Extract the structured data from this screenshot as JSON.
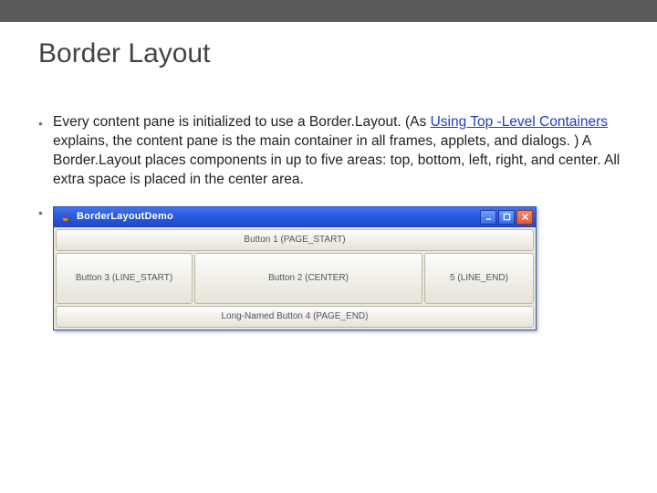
{
  "slide": {
    "title": "Border Layout",
    "paragraph_pre": "Every content pane is initialized to use a Border.Layout. (As ",
    "link_text": "Using Top -Level Containers",
    "paragraph_post": " explains, the content pane is the main container in all frames, applets, and dialogs. ) A Border.Layout places components in up to five areas: top, bottom, left, right, and center. All extra space is placed in the center area."
  },
  "window": {
    "title": "BorderLayoutDemo",
    "icon_name": "java-cup-icon",
    "controls": {
      "min_name": "minimize-icon",
      "max_name": "maximize-icon",
      "close_name": "close-icon"
    },
    "buttons": {
      "top": "Button 1 (PAGE_START)",
      "left": "Button 3 (LINE_START)",
      "center": "Button 2 (CENTER)",
      "right": "5 (LINE_END)",
      "bottom": "Long-Named Button 4 (PAGE_END)"
    }
  }
}
